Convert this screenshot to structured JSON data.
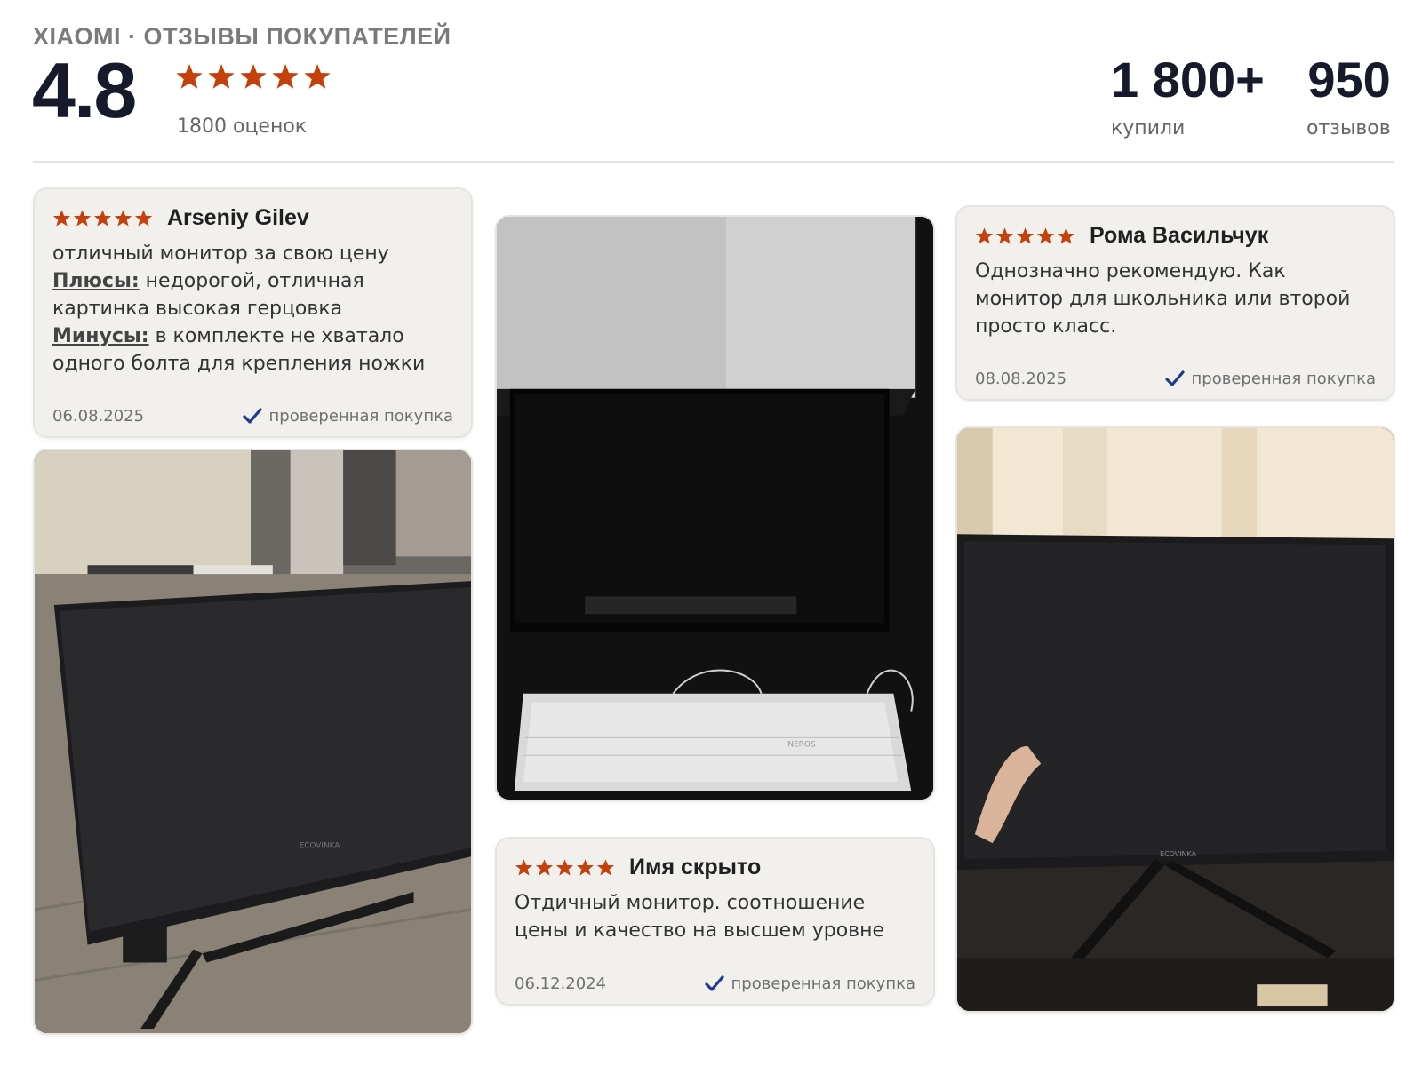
{
  "header": {
    "brand_line": "XIAOMI · ОТЗЫВЫ ПОКУПАТЕЛЕЙ",
    "rating_value": "4.8",
    "rating_stars": 5,
    "rating_count_label": "1800 оценок",
    "stats": [
      {
        "value": "1 800+",
        "label": "купили"
      },
      {
        "value": "950",
        "label": "отзывов"
      }
    ]
  },
  "colors": {
    "star": "#c2410c",
    "card_bg": "#f1f0ed",
    "verified_check": "#1e3a8a",
    "heading": "#161a2b"
  },
  "reviews": [
    {
      "author": "Arseniy Gilev",
      "stars": 5,
      "text_intro": "отличный монитор за свою цену",
      "pros_label": "Плюсы:",
      "pros_text": "недорогой, отличная картинка высокая герцовка",
      "cons_label": "Минусы:",
      "cons_text": "в комплекте не хватало одного болта для крепления ножки",
      "date": "06.08.2025",
      "verified_label": "проверенная покупка"
    },
    {
      "author": "Рома Васильчук",
      "stars": 5,
      "text": "Однозначно рекомендую. Как монитор для школьника или второй просто класс.",
      "date": "08.08.2025",
      "verified_label": "проверенная покупка"
    },
    {
      "author": "Имя скрыто",
      "stars": 5,
      "text": "Отдичный монитор. соотношение цены и качество на высшем уровне",
      "date": "06.12.2024",
      "verified_label": "проверенная покупка"
    }
  ],
  "photos": [
    {
      "subject": "monitor-on-floor-photo",
      "brand_on_bezel": "ECOVINKA"
    },
    {
      "subject": "monitor-with-keyboard-photo",
      "brand_on_keyboard": "NEROS"
    },
    {
      "subject": "monitor-on-desk-photo",
      "brand_on_bezel": "ECOVINKA"
    }
  ]
}
